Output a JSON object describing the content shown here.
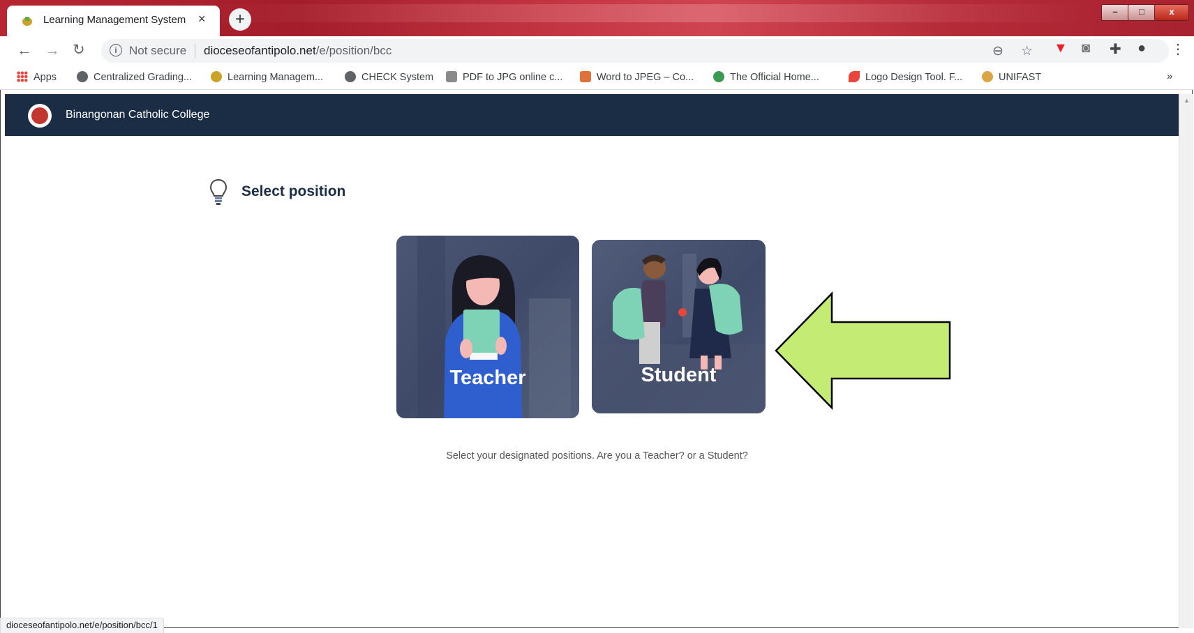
{
  "browser": {
    "tab_title": "Learning Management System",
    "tab_close": "×",
    "new_tab": "+",
    "omnibox": {
      "security_label": "Not secure",
      "url_domain": "dioceseofantipolo.net",
      "url_path": "/e/position/bcc"
    },
    "bookmarks": [
      {
        "label": "Apps",
        "color": "#e8453c"
      },
      {
        "label": "Centralized Grading...",
        "color": "#5f6368"
      },
      {
        "label": "Learning Managem...",
        "color": "#c9a227"
      },
      {
        "label": "CHECK System",
        "color": "#5f6368"
      },
      {
        "label": "PDF to JPG online c...",
        "color": "#8a8a8a"
      },
      {
        "label": "Word to JPEG – Co...",
        "color": "#e0713a"
      },
      {
        "label": "The Official Home...",
        "color": "#3a9a54"
      },
      {
        "label": "Logo Design Tool. F...",
        "color": "#e8453c"
      },
      {
        "label": "UNIFAST",
        "color": "#d9a441"
      }
    ],
    "bookmarks_more": "»",
    "status_url": "dioceseofantipolo.net/e/position/bcc/1"
  },
  "site": {
    "name": "Binangonan Catholic College",
    "header_color": "#1b2d45"
  },
  "page": {
    "title": "Select position",
    "cards": {
      "teacher": "Teacher",
      "student": "Student"
    },
    "help_text": "Select your designated positions. Are you a Teacher? or a Student?"
  },
  "annotation": {
    "arrow_color": "#c4ec74"
  }
}
